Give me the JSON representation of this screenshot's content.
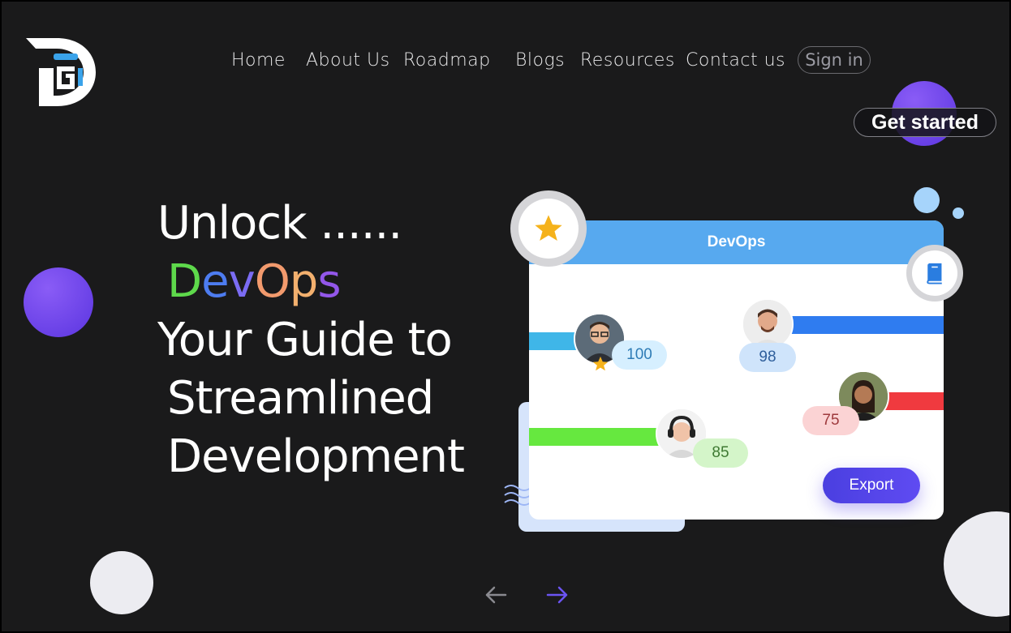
{
  "brand": {
    "logo_icon": "dg-logo-icon"
  },
  "nav": {
    "items": [
      {
        "label": "Home"
      },
      {
        "label": "About Us"
      },
      {
        "label": "Roadmap"
      },
      {
        "label": "Blogs"
      },
      {
        "label": "Resources"
      },
      {
        "label": "Contact us"
      }
    ],
    "signin_label": "Sign in",
    "get_started_label": "Get started"
  },
  "hero": {
    "line1": "Unlock ......",
    "devops_letters": [
      "D",
      "e",
      "v",
      "O",
      "p",
      "s"
    ],
    "line3": "Your Guide to",
    "line4": "Streamlined",
    "line5": "Development"
  },
  "card": {
    "title": "DevOps",
    "scores": [
      "100",
      "98",
      "85",
      "75"
    ],
    "export_label": "Export",
    "colors": {
      "header": "#57a9ef",
      "bar1": "#3fb6e8",
      "bar2": "#2f7cf0",
      "bar3": "#66e83f",
      "bar4": "#f03a3f"
    }
  },
  "icons": {
    "star": "star-icon",
    "book": "book-icon",
    "waves": "waves-icon",
    "prev": "arrow-left-icon",
    "next": "arrow-right-icon"
  },
  "colors": {
    "background": "#1a1a1b",
    "accent": "#5b35e0"
  }
}
